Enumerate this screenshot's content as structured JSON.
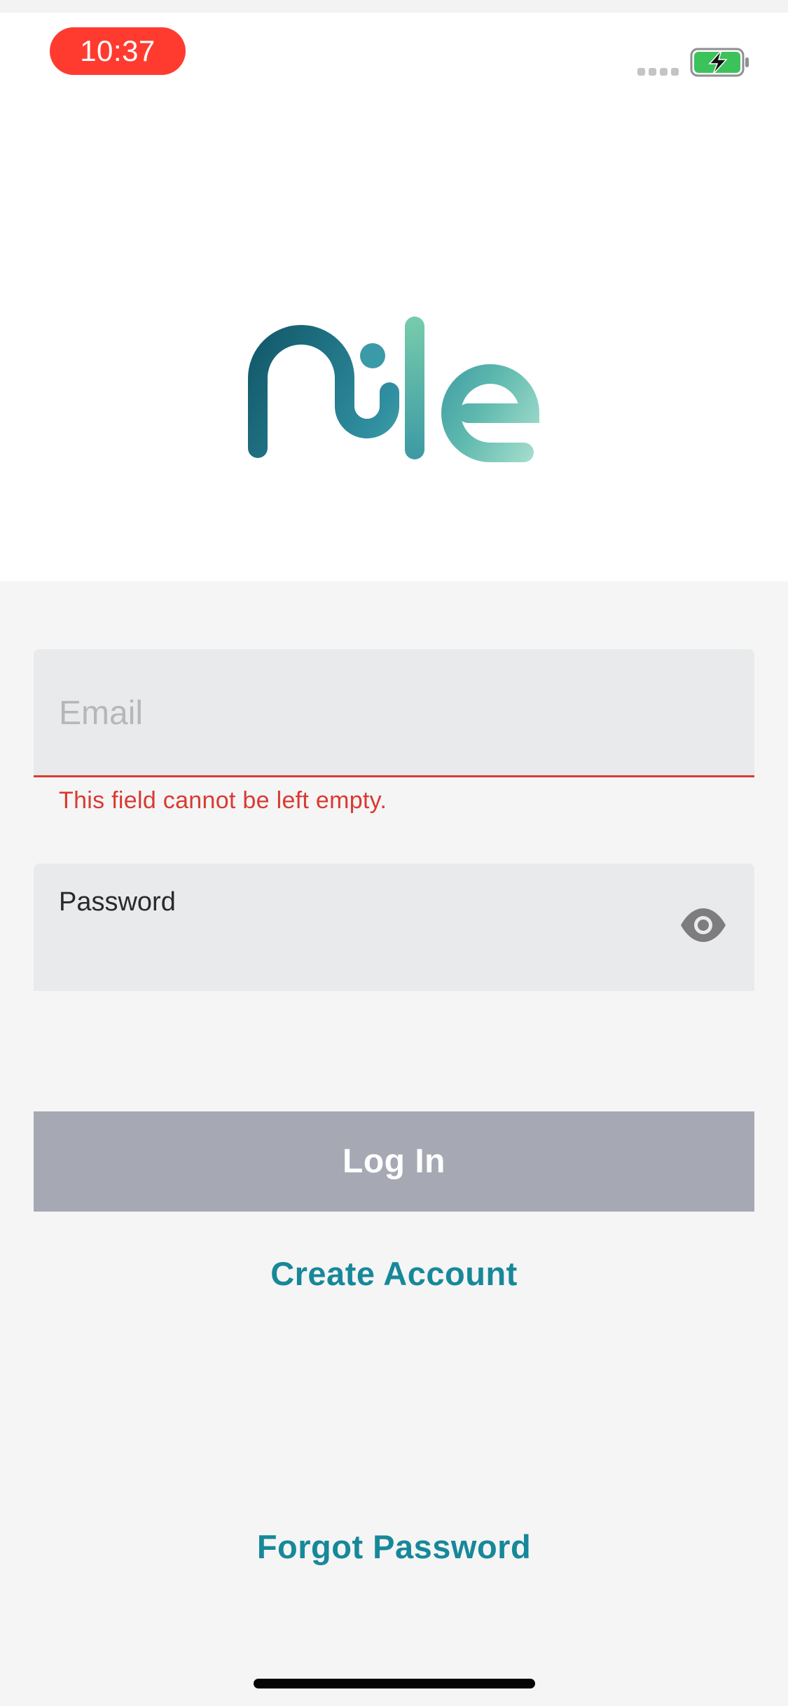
{
  "status_bar": {
    "time": "10:37",
    "time_pill_color": "#ff3b30",
    "signal_icon": "signal-dots-icon",
    "battery_icon": "battery-charging-icon",
    "battery_color": "#3cc25a"
  },
  "logo": {
    "brand": "nile",
    "gradient_start": "#0d4f61",
    "gradient_mid": "#2f8fa0",
    "gradient_end": "#a9e1cf"
  },
  "form": {
    "email": {
      "placeholder": "Email",
      "value": "",
      "error": "This field cannot be left empty."
    },
    "password": {
      "label": "Password",
      "value": "",
      "toggle_icon": "eye-icon"
    },
    "login_label": "Log In",
    "create_account_label": "Create Account",
    "forgot_password_label": "Forgot Password"
  },
  "colors": {
    "error": "#d93a31",
    "link": "#17889a",
    "button_disabled": "#a6a8b4",
    "field_background": "#e9eaec"
  }
}
